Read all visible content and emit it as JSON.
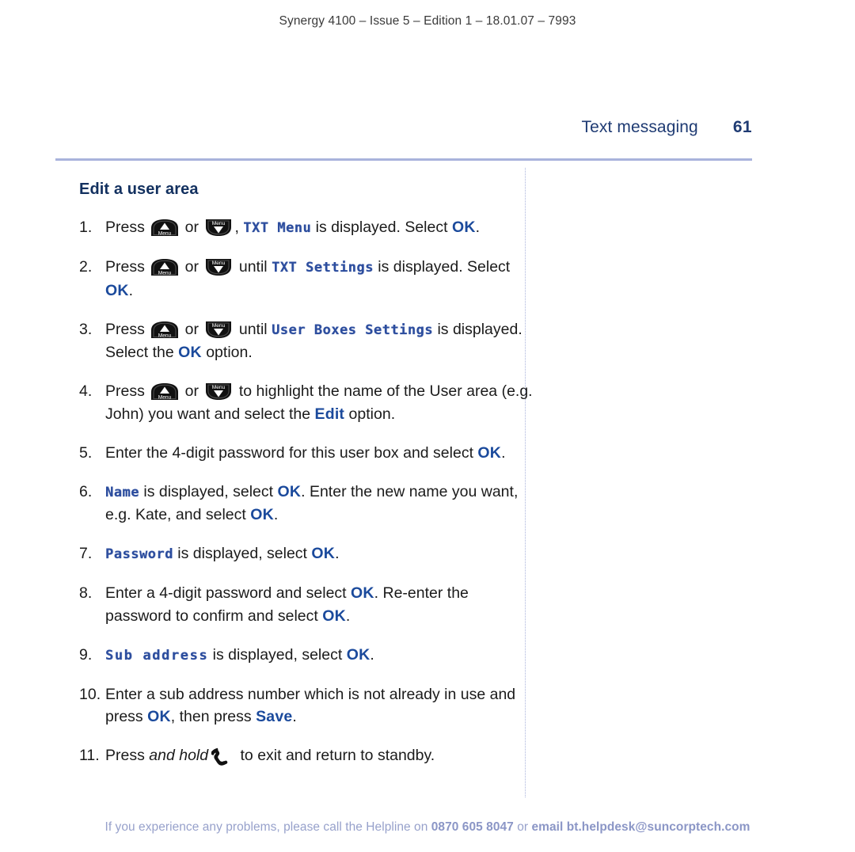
{
  "running_head": "Synergy 4100 – Issue 5 – Edition 1 – 18.01.07 – 7993",
  "chapter": {
    "title": "Text messaging",
    "page_number": "61"
  },
  "section": {
    "heading": "Edit a user area"
  },
  "colors": {
    "accent_blue": "#1b4a9c",
    "chapter_blue": "#1f3b73",
    "lcd_blue": "#2c4d9e",
    "rule": "#a9b3dc",
    "footer": "#97a1cb"
  },
  "icons": {
    "menu_up_label": "Menu",
    "menu_down_label": "Menu",
    "handset": "handset-end-call-icon"
  },
  "steps": [
    {
      "num": "1.",
      "parts": [
        {
          "t": "text",
          "v": "Press "
        },
        {
          "t": "key-up"
        },
        {
          "t": "text",
          "v": " or "
        },
        {
          "t": "key-down"
        },
        {
          "t": "text",
          "v": ", "
        },
        {
          "t": "lcd",
          "v": "TXT Menu"
        },
        {
          "t": "text",
          "v": " is displayed. Select "
        },
        {
          "t": "ok",
          "v": "OK"
        },
        {
          "t": "text",
          "v": "."
        }
      ]
    },
    {
      "num": "2.",
      "parts": [
        {
          "t": "text",
          "v": "Press "
        },
        {
          "t": "key-up"
        },
        {
          "t": "text",
          "v": " or "
        },
        {
          "t": "key-down"
        },
        {
          "t": "text",
          "v": " until "
        },
        {
          "t": "lcd",
          "v": "TXT Settings"
        },
        {
          "t": "text",
          "v": " is displayed. Select "
        },
        {
          "t": "ok",
          "v": "OK"
        },
        {
          "t": "text",
          "v": "."
        }
      ]
    },
    {
      "num": "3.",
      "parts": [
        {
          "t": "text",
          "v": "Press "
        },
        {
          "t": "key-up"
        },
        {
          "t": "text",
          "v": " or "
        },
        {
          "t": "key-down"
        },
        {
          "t": "text",
          "v": " until "
        },
        {
          "t": "lcd",
          "v": "User Boxes Settings"
        },
        {
          "t": "text",
          "v": " is displayed. Select the "
        },
        {
          "t": "ok",
          "v": "OK"
        },
        {
          "t": "text",
          "v": " option."
        }
      ]
    },
    {
      "num": "4.",
      "parts": [
        {
          "t": "text",
          "v": "Press "
        },
        {
          "t": "key-up"
        },
        {
          "t": "text",
          "v": " or "
        },
        {
          "t": "key-down"
        },
        {
          "t": "text",
          "v": " to highlight the name of the User area (e.g. John) you want and select the "
        },
        {
          "t": "ok",
          "v": "Edit"
        },
        {
          "t": "text",
          "v": " option."
        }
      ]
    },
    {
      "num": "5.",
      "parts": [
        {
          "t": "text",
          "v": "Enter the 4-digit password for this user box and select "
        },
        {
          "t": "ok",
          "v": "OK"
        },
        {
          "t": "text",
          "v": "."
        }
      ]
    },
    {
      "num": "6.",
      "parts": [
        {
          "t": "lcd",
          "v": "Name"
        },
        {
          "t": "text",
          "v": " is displayed, select "
        },
        {
          "t": "ok",
          "v": "OK"
        },
        {
          "t": "text",
          "v": ". Enter the new name you want, e.g. Kate, and select "
        },
        {
          "t": "ok",
          "v": "OK"
        },
        {
          "t": "text",
          "v": "."
        }
      ]
    },
    {
      "num": "7.",
      "parts": [
        {
          "t": "lcd",
          "v": "Password"
        },
        {
          "t": "text",
          "v": " is displayed, select "
        },
        {
          "t": "ok",
          "v": "OK"
        },
        {
          "t": "text",
          "v": "."
        }
      ]
    },
    {
      "num": "8.",
      "parts": [
        {
          "t": "text",
          "v": "Enter a 4-digit password and select "
        },
        {
          "t": "ok",
          "v": "OK"
        },
        {
          "t": "text",
          "v": ". Re-enter the password to confirm and select "
        },
        {
          "t": "ok",
          "v": "OK"
        },
        {
          "t": "text",
          "v": "."
        }
      ]
    },
    {
      "num": "9.",
      "parts": [
        {
          "t": "lcd-sp",
          "v": "Sub address"
        },
        {
          "t": "text",
          "v": " is displayed, select "
        },
        {
          "t": "ok",
          "v": "OK"
        },
        {
          "t": "text",
          "v": "."
        }
      ]
    },
    {
      "num": "10.",
      "parts": [
        {
          "t": "text",
          "v": "Enter a sub address number which is not already in use and press "
        },
        {
          "t": "ok",
          "v": "OK"
        },
        {
          "t": "text",
          "v": ", then press "
        },
        {
          "t": "ok",
          "v": "Save"
        },
        {
          "t": "text",
          "v": "."
        }
      ]
    },
    {
      "num": "11.",
      "parts": [
        {
          "t": "text",
          "v": "Press "
        },
        {
          "t": "ital",
          "v": "and hold"
        },
        {
          "t": "handset"
        },
        {
          "t": "text",
          "v": " to exit and return to standby."
        }
      ]
    }
  ],
  "footer": {
    "lead": "If you experience any problems, please call the Helpline on ",
    "phone": "0870 605 8047",
    "mid": " or ",
    "email": "email bt.helpdesk@suncorptech.com"
  }
}
